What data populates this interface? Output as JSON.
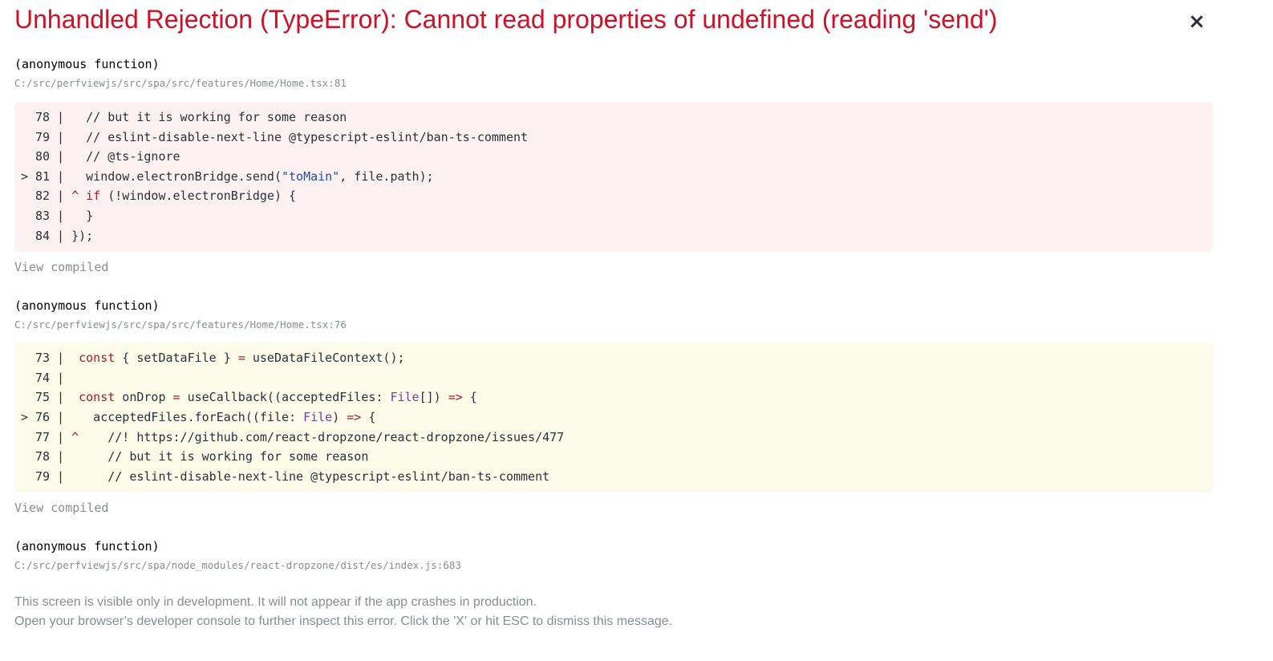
{
  "header": {
    "title": "Unhandled Rejection (TypeError): Cannot read properties of undefined (reading 'send')",
    "close_label": "×"
  },
  "frames": [
    {
      "function_name": "(anonymous function)",
      "location": "C:/src/perfviewjs/src/spa/src/features/Home/Home.tsx:81",
      "view_compiled_label": "View compiled",
      "code_lines": [
        {
          "num": "78",
          "marker": "",
          "sep": " |   ",
          "code": "// but it is working for some reason"
        },
        {
          "num": "79",
          "marker": "",
          "sep": " |   ",
          "code": "// eslint-disable-next-line @typescript-eslint/ban-ts-comment"
        },
        {
          "num": "80",
          "marker": "",
          "sep": " |   ",
          "code": "// @ts-ignore"
        },
        {
          "num": "81",
          "marker": ">",
          "sep": " |   ",
          "code_a": "window.electronBridge.send(",
          "code_str": "\"toMain\"",
          "code_b": ", file.path);"
        },
        {
          "num": "82",
          "marker": "",
          "sep": " | ",
          "caret": "^",
          "code_kw": "if",
          "code": " (!window.electronBridge) {"
        },
        {
          "num": "83",
          "marker": "",
          "sep": " |   ",
          "code": "}"
        },
        {
          "num": "84",
          "marker": "",
          "sep": " | ",
          "code": "});"
        }
      ]
    },
    {
      "function_name": "(anonymous function)",
      "location": "C:/src/perfviewjs/src/spa/src/features/Home/Home.tsx:76",
      "view_compiled_label": "View compiled",
      "code_lines": [
        {
          "num": "73",
          "kw": "const",
          "code": " { setDataFile } ",
          "op": "=",
          "code2": " useDataFileContext();"
        },
        {
          "num": "74"
        },
        {
          "num": "75",
          "kw": "const",
          "code": " onDrop ",
          "op": "=",
          "code2": " useCallback((acceptedFiles: ",
          "typ": "File",
          "code3": "[]) ",
          "op2": "=>",
          "code4": " {"
        },
        {
          "num": "76",
          "marker": ">",
          "code": "  acceptedFiles.forEach((file: ",
          "typ": "File",
          "code2": ") ",
          "op": "=>",
          "code3": " {"
        },
        {
          "num": "77",
          "caret": "^",
          "code": "    //! https://github.com/react-dropzone/react-dropzone/issues/477"
        },
        {
          "num": "78",
          "code": "    // but it is working for some reason"
        },
        {
          "num": "79",
          "code": "    // eslint-disable-next-line @typescript-eslint/ban-ts-comment"
        }
      ]
    },
    {
      "function_name": "(anonymous function)",
      "location": "C:/src/perfviewjs/src/spa/node_modules/react-dropzone/dist/es/index.js:683"
    }
  ],
  "footer": {
    "line1": "This screen is visible only in development. It will not appear if the app crashes in production.",
    "line2": "Open your browser’s developer console to further inspect this error.  Click the 'X' or hit ESC to dismiss this message."
  }
}
